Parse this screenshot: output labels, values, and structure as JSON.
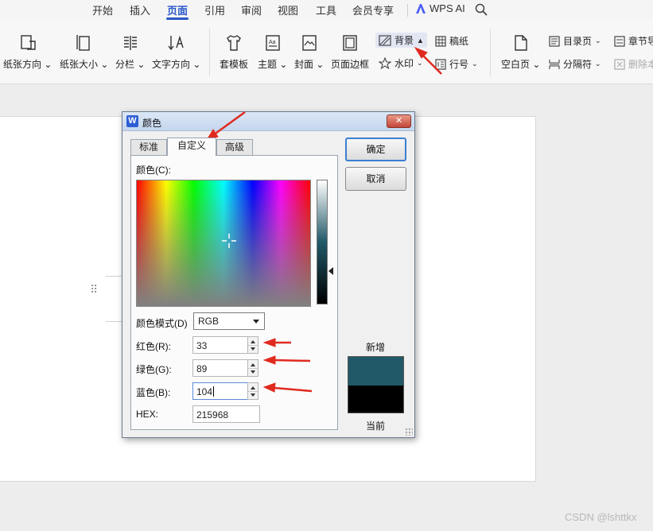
{
  "menu": {
    "items": [
      "开始",
      "插入",
      "页面",
      "引用",
      "审阅",
      "视图",
      "工具",
      "会员专享"
    ],
    "active": "页面",
    "ai_label": "WPS AI"
  },
  "ribbon": {
    "paper_orientation": "纸张方向",
    "paper_size": "纸张大小",
    "columns": "分栏",
    "text_direction": "文字方向",
    "template": "套模板",
    "theme": "主题",
    "cover": "封面",
    "page_border": "页面边框",
    "background": "背景",
    "watermark": "水印",
    "manuscript": "稿纸",
    "line_number": "行号",
    "blank_page": "空白页",
    "toc_page": "目录页",
    "separator": "分隔符",
    "chapter": "章节导",
    "delete_page": "删除本"
  },
  "dialog": {
    "title": "颜色",
    "close": "✕",
    "tabs": [
      "标准",
      "自定义",
      "高级"
    ],
    "active_tab": "自定义",
    "color_label": "颜色(C):",
    "mode_label": "颜色模式(D)",
    "mode_value": "RGB",
    "red_label": "红色(R):",
    "red_value": "33",
    "green_label": "绿色(G):",
    "green_value": "89",
    "blue_label": "蓝色(B):",
    "blue_value": "104",
    "hex_label": "HEX:",
    "hex_value": "215968",
    "ok": "确定",
    "cancel": "取消",
    "new_label": "新增",
    "current_label": "当前",
    "new_color": "#215968",
    "current_color": "#000000"
  },
  "watermark_text": "CSDN @lshttkx",
  "colors": {
    "accent": "#2b57c9",
    "annotation_arrow": "#e02a1f"
  }
}
